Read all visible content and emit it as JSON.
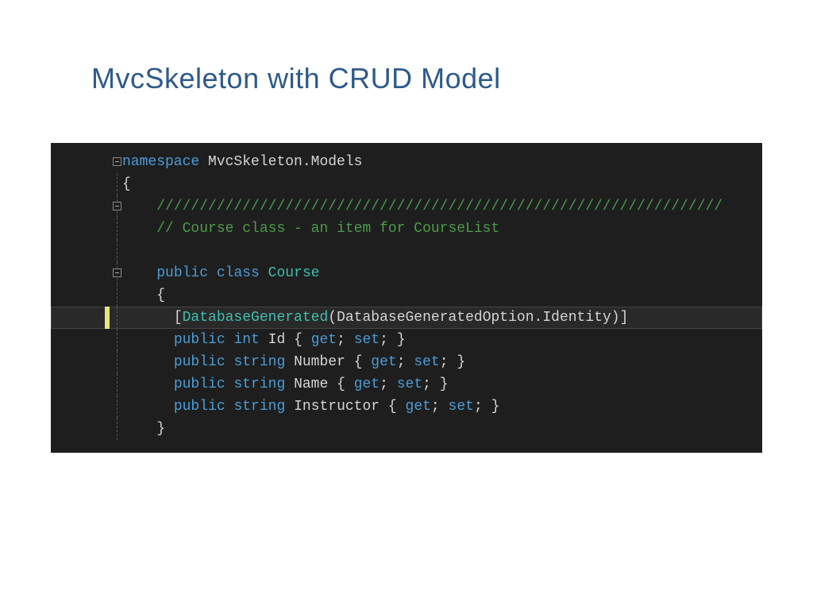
{
  "title": "MvcSkeleton with CRUD Model",
  "code": {
    "ns_kw": "namespace",
    "ns_name": "MvcSkeleton.Models",
    "brace_open": "{",
    "brace_close": "}",
    "comment_bar": "//////////////////////////////////////////////////////////////////",
    "comment_desc": "// Course class - an item for CourseList",
    "public": "public",
    "class": "class",
    "class_name": "Course",
    "attr_open": "[",
    "attr_name": "DatabaseGenerated",
    "attr_paren_open": "(",
    "attr_arg_type": "DatabaseGeneratedOption",
    "attr_dot": ".",
    "attr_arg_member": "Identity",
    "attr_paren_close": ")",
    "attr_close": "]",
    "int": "int",
    "string": "string",
    "prop_id": "Id",
    "prop_number": "Number",
    "prop_name": "Name",
    "prop_instructor": "Instructor",
    "getset_open": "{ ",
    "get": "get",
    "semi": ";",
    "sp": " ",
    "set": "set",
    "getset_close": " }"
  }
}
